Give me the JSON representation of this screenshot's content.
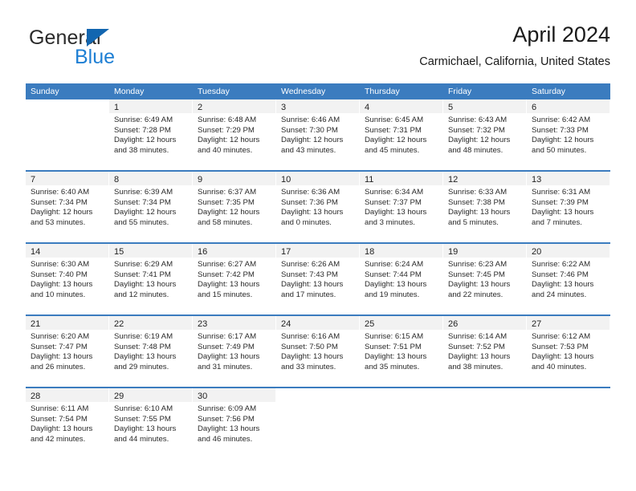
{
  "brand": {
    "name_part1": "General",
    "name_part2": "Blue",
    "triangle_color": "#1266b0",
    "blue_color": "#1e7fd4"
  },
  "header": {
    "title": "April 2024",
    "location": "Carmichael, California, United States"
  },
  "theme": {
    "header_blue": "#3b7cbf",
    "day_number_bg": "#f2f2f2",
    "text": "#222222"
  },
  "weekdays": [
    "Sunday",
    "Monday",
    "Tuesday",
    "Wednesday",
    "Thursday",
    "Friday",
    "Saturday"
  ],
  "labels": {
    "sunrise_prefix": "Sunrise:",
    "sunset_prefix": "Sunset:",
    "daylight_prefix": "Daylight:"
  },
  "weeks": [
    [
      {
        "day": "",
        "empty": true
      },
      {
        "day": "1",
        "sunrise": "Sunrise: 6:49 AM",
        "sunset": "Sunset: 7:28 PM",
        "daylight1": "Daylight: 12 hours",
        "daylight2": "and 38 minutes."
      },
      {
        "day": "2",
        "sunrise": "Sunrise: 6:48 AM",
        "sunset": "Sunset: 7:29 PM",
        "daylight1": "Daylight: 12 hours",
        "daylight2": "and 40 minutes."
      },
      {
        "day": "3",
        "sunrise": "Sunrise: 6:46 AM",
        "sunset": "Sunset: 7:30 PM",
        "daylight1": "Daylight: 12 hours",
        "daylight2": "and 43 minutes."
      },
      {
        "day": "4",
        "sunrise": "Sunrise: 6:45 AM",
        "sunset": "Sunset: 7:31 PM",
        "daylight1": "Daylight: 12 hours",
        "daylight2": "and 45 minutes."
      },
      {
        "day": "5",
        "sunrise": "Sunrise: 6:43 AM",
        "sunset": "Sunset: 7:32 PM",
        "daylight1": "Daylight: 12 hours",
        "daylight2": "and 48 minutes."
      },
      {
        "day": "6",
        "sunrise": "Sunrise: 6:42 AM",
        "sunset": "Sunset: 7:33 PM",
        "daylight1": "Daylight: 12 hours",
        "daylight2": "and 50 minutes."
      }
    ],
    [
      {
        "day": "7",
        "sunrise": "Sunrise: 6:40 AM",
        "sunset": "Sunset: 7:34 PM",
        "daylight1": "Daylight: 12 hours",
        "daylight2": "and 53 minutes."
      },
      {
        "day": "8",
        "sunrise": "Sunrise: 6:39 AM",
        "sunset": "Sunset: 7:34 PM",
        "daylight1": "Daylight: 12 hours",
        "daylight2": "and 55 minutes."
      },
      {
        "day": "9",
        "sunrise": "Sunrise: 6:37 AM",
        "sunset": "Sunset: 7:35 PM",
        "daylight1": "Daylight: 12 hours",
        "daylight2": "and 58 minutes."
      },
      {
        "day": "10",
        "sunrise": "Sunrise: 6:36 AM",
        "sunset": "Sunset: 7:36 PM",
        "daylight1": "Daylight: 13 hours",
        "daylight2": "and 0 minutes."
      },
      {
        "day": "11",
        "sunrise": "Sunrise: 6:34 AM",
        "sunset": "Sunset: 7:37 PM",
        "daylight1": "Daylight: 13 hours",
        "daylight2": "and 3 minutes."
      },
      {
        "day": "12",
        "sunrise": "Sunrise: 6:33 AM",
        "sunset": "Sunset: 7:38 PM",
        "daylight1": "Daylight: 13 hours",
        "daylight2": "and 5 minutes."
      },
      {
        "day": "13",
        "sunrise": "Sunrise: 6:31 AM",
        "sunset": "Sunset: 7:39 PM",
        "daylight1": "Daylight: 13 hours",
        "daylight2": "and 7 minutes."
      }
    ],
    [
      {
        "day": "14",
        "sunrise": "Sunrise: 6:30 AM",
        "sunset": "Sunset: 7:40 PM",
        "daylight1": "Daylight: 13 hours",
        "daylight2": "and 10 minutes."
      },
      {
        "day": "15",
        "sunrise": "Sunrise: 6:29 AM",
        "sunset": "Sunset: 7:41 PM",
        "daylight1": "Daylight: 13 hours",
        "daylight2": "and 12 minutes."
      },
      {
        "day": "16",
        "sunrise": "Sunrise: 6:27 AM",
        "sunset": "Sunset: 7:42 PM",
        "daylight1": "Daylight: 13 hours",
        "daylight2": "and 15 minutes."
      },
      {
        "day": "17",
        "sunrise": "Sunrise: 6:26 AM",
        "sunset": "Sunset: 7:43 PM",
        "daylight1": "Daylight: 13 hours",
        "daylight2": "and 17 minutes."
      },
      {
        "day": "18",
        "sunrise": "Sunrise: 6:24 AM",
        "sunset": "Sunset: 7:44 PM",
        "daylight1": "Daylight: 13 hours",
        "daylight2": "and 19 minutes."
      },
      {
        "day": "19",
        "sunrise": "Sunrise: 6:23 AM",
        "sunset": "Sunset: 7:45 PM",
        "daylight1": "Daylight: 13 hours",
        "daylight2": "and 22 minutes."
      },
      {
        "day": "20",
        "sunrise": "Sunrise: 6:22 AM",
        "sunset": "Sunset: 7:46 PM",
        "daylight1": "Daylight: 13 hours",
        "daylight2": "and 24 minutes."
      }
    ],
    [
      {
        "day": "21",
        "sunrise": "Sunrise: 6:20 AM",
        "sunset": "Sunset: 7:47 PM",
        "daylight1": "Daylight: 13 hours",
        "daylight2": "and 26 minutes."
      },
      {
        "day": "22",
        "sunrise": "Sunrise: 6:19 AM",
        "sunset": "Sunset: 7:48 PM",
        "daylight1": "Daylight: 13 hours",
        "daylight2": "and 29 minutes."
      },
      {
        "day": "23",
        "sunrise": "Sunrise: 6:17 AM",
        "sunset": "Sunset: 7:49 PM",
        "daylight1": "Daylight: 13 hours",
        "daylight2": "and 31 minutes."
      },
      {
        "day": "24",
        "sunrise": "Sunrise: 6:16 AM",
        "sunset": "Sunset: 7:50 PM",
        "daylight1": "Daylight: 13 hours",
        "daylight2": "and 33 minutes."
      },
      {
        "day": "25",
        "sunrise": "Sunrise: 6:15 AM",
        "sunset": "Sunset: 7:51 PM",
        "daylight1": "Daylight: 13 hours",
        "daylight2": "and 35 minutes."
      },
      {
        "day": "26",
        "sunrise": "Sunrise: 6:14 AM",
        "sunset": "Sunset: 7:52 PM",
        "daylight1": "Daylight: 13 hours",
        "daylight2": "and 38 minutes."
      },
      {
        "day": "27",
        "sunrise": "Sunrise: 6:12 AM",
        "sunset": "Sunset: 7:53 PM",
        "daylight1": "Daylight: 13 hours",
        "daylight2": "and 40 minutes."
      }
    ],
    [
      {
        "day": "28",
        "sunrise": "Sunrise: 6:11 AM",
        "sunset": "Sunset: 7:54 PM",
        "daylight1": "Daylight: 13 hours",
        "daylight2": "and 42 minutes."
      },
      {
        "day": "29",
        "sunrise": "Sunrise: 6:10 AM",
        "sunset": "Sunset: 7:55 PM",
        "daylight1": "Daylight: 13 hours",
        "daylight2": "and 44 minutes."
      },
      {
        "day": "30",
        "sunrise": "Sunrise: 6:09 AM",
        "sunset": "Sunset: 7:56 PM",
        "daylight1": "Daylight: 13 hours",
        "daylight2": "and 46 minutes."
      },
      {
        "day": "",
        "empty": true
      },
      {
        "day": "",
        "empty": true
      },
      {
        "day": "",
        "empty": true
      },
      {
        "day": "",
        "empty": true
      }
    ]
  ]
}
